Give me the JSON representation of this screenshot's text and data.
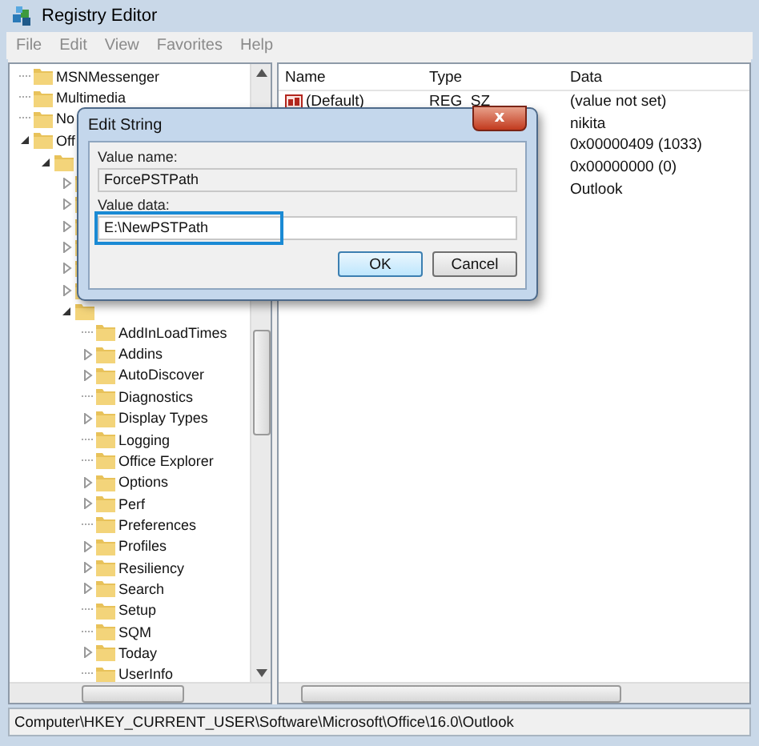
{
  "window": {
    "title": "Registry Editor"
  },
  "menu": [
    "File",
    "Edit",
    "View",
    "Favorites",
    "Help"
  ],
  "tree": [
    {
      "label": "MSNMessenger"
    },
    {
      "label": "Multimedia"
    },
    {
      "label": "No"
    },
    {
      "label": "Off",
      "expanded": true,
      "children": [
        {
          "expanded": true,
          "children": [
            {
              "expanded": false
            },
            {
              "expanded": false
            },
            {
              "expanded": false
            },
            {
              "expanded": false
            },
            {
              "expanded": false
            },
            {
              "expanded": false
            },
            {
              "expanded": true,
              "children": [
                {
                  "label": "AddInLoadTimes"
                },
                {
                  "label": "Addins",
                  "expanded": false
                },
                {
                  "label": "AutoDiscover",
                  "expanded": false
                },
                {
                  "label": "Diagnostics"
                },
                {
                  "label": "Display Types",
                  "expanded": false
                },
                {
                  "label": "Logging"
                },
                {
                  "label": "Office Explorer"
                },
                {
                  "label": "Options",
                  "expanded": false
                },
                {
                  "label": "Perf",
                  "expanded": false
                },
                {
                  "label": "Preferences"
                },
                {
                  "label": "Profiles",
                  "expanded": false
                },
                {
                  "label": "Resiliency",
                  "expanded": false
                },
                {
                  "label": "Search",
                  "expanded": false
                },
                {
                  "label": "Setup"
                },
                {
                  "label": "SQM"
                },
                {
                  "label": "Today",
                  "expanded": false
                },
                {
                  "label": "UserInfo"
                }
              ]
            }
          ]
        }
      ]
    }
  ],
  "values": {
    "columns": [
      "Name",
      "Type",
      "Data"
    ],
    "rows": [
      {
        "name": "(Default)",
        "type": "REG_SZ",
        "data": "(value not set)"
      },
      {
        "data": "nikita"
      },
      {
        "data": "0x00000409 (1033)"
      },
      {
        "data": "0x00000000 (0)"
      },
      {
        "data": "Outlook"
      }
    ]
  },
  "status_bar": "Computer\\HKEY_CURRENT_USER\\Software\\Microsoft\\Office\\16.0\\Outlook",
  "dialog": {
    "title": "Edit String",
    "close": "x",
    "name_label": "Value name:",
    "name_value": "ForcePSTPath",
    "data_label": "Value data:",
    "data_value": "E:\\NewPSTPath",
    "buttons": [
      "OK",
      "Cancel"
    ]
  }
}
